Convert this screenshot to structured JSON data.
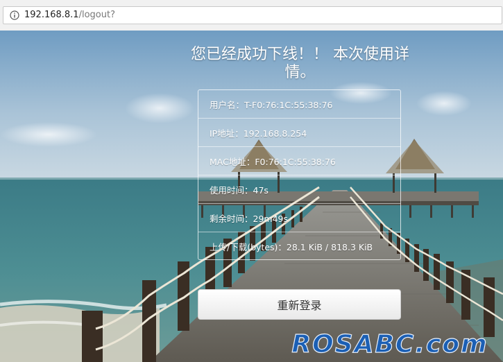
{
  "browser": {
    "url_host": "192.168.8.1",
    "url_path": "/logout?",
    "info_icon": "info-icon"
  },
  "page": {
    "title": "您已经成功下线！！ 本次使用详情。",
    "details": [
      "用户名：T-F0:76:1C:55:38:76",
      "IP地址：192.168.8.254",
      "MAC地址：F0:76:1C:55:38:76",
      "使用时间：47s",
      "剩余时间：29m49s",
      "上传/下载(bytes)：28.1 KiB / 818.3 KiB"
    ],
    "relogin_label": "重新登录"
  },
  "watermark": {
    "text": "ROSABC.com"
  },
  "colors": {
    "sky_top": "#6f9cc2",
    "sea": "#3f7f86",
    "pier_wood": "#8a8a86",
    "watermark_fill": "#1b5fb4"
  }
}
